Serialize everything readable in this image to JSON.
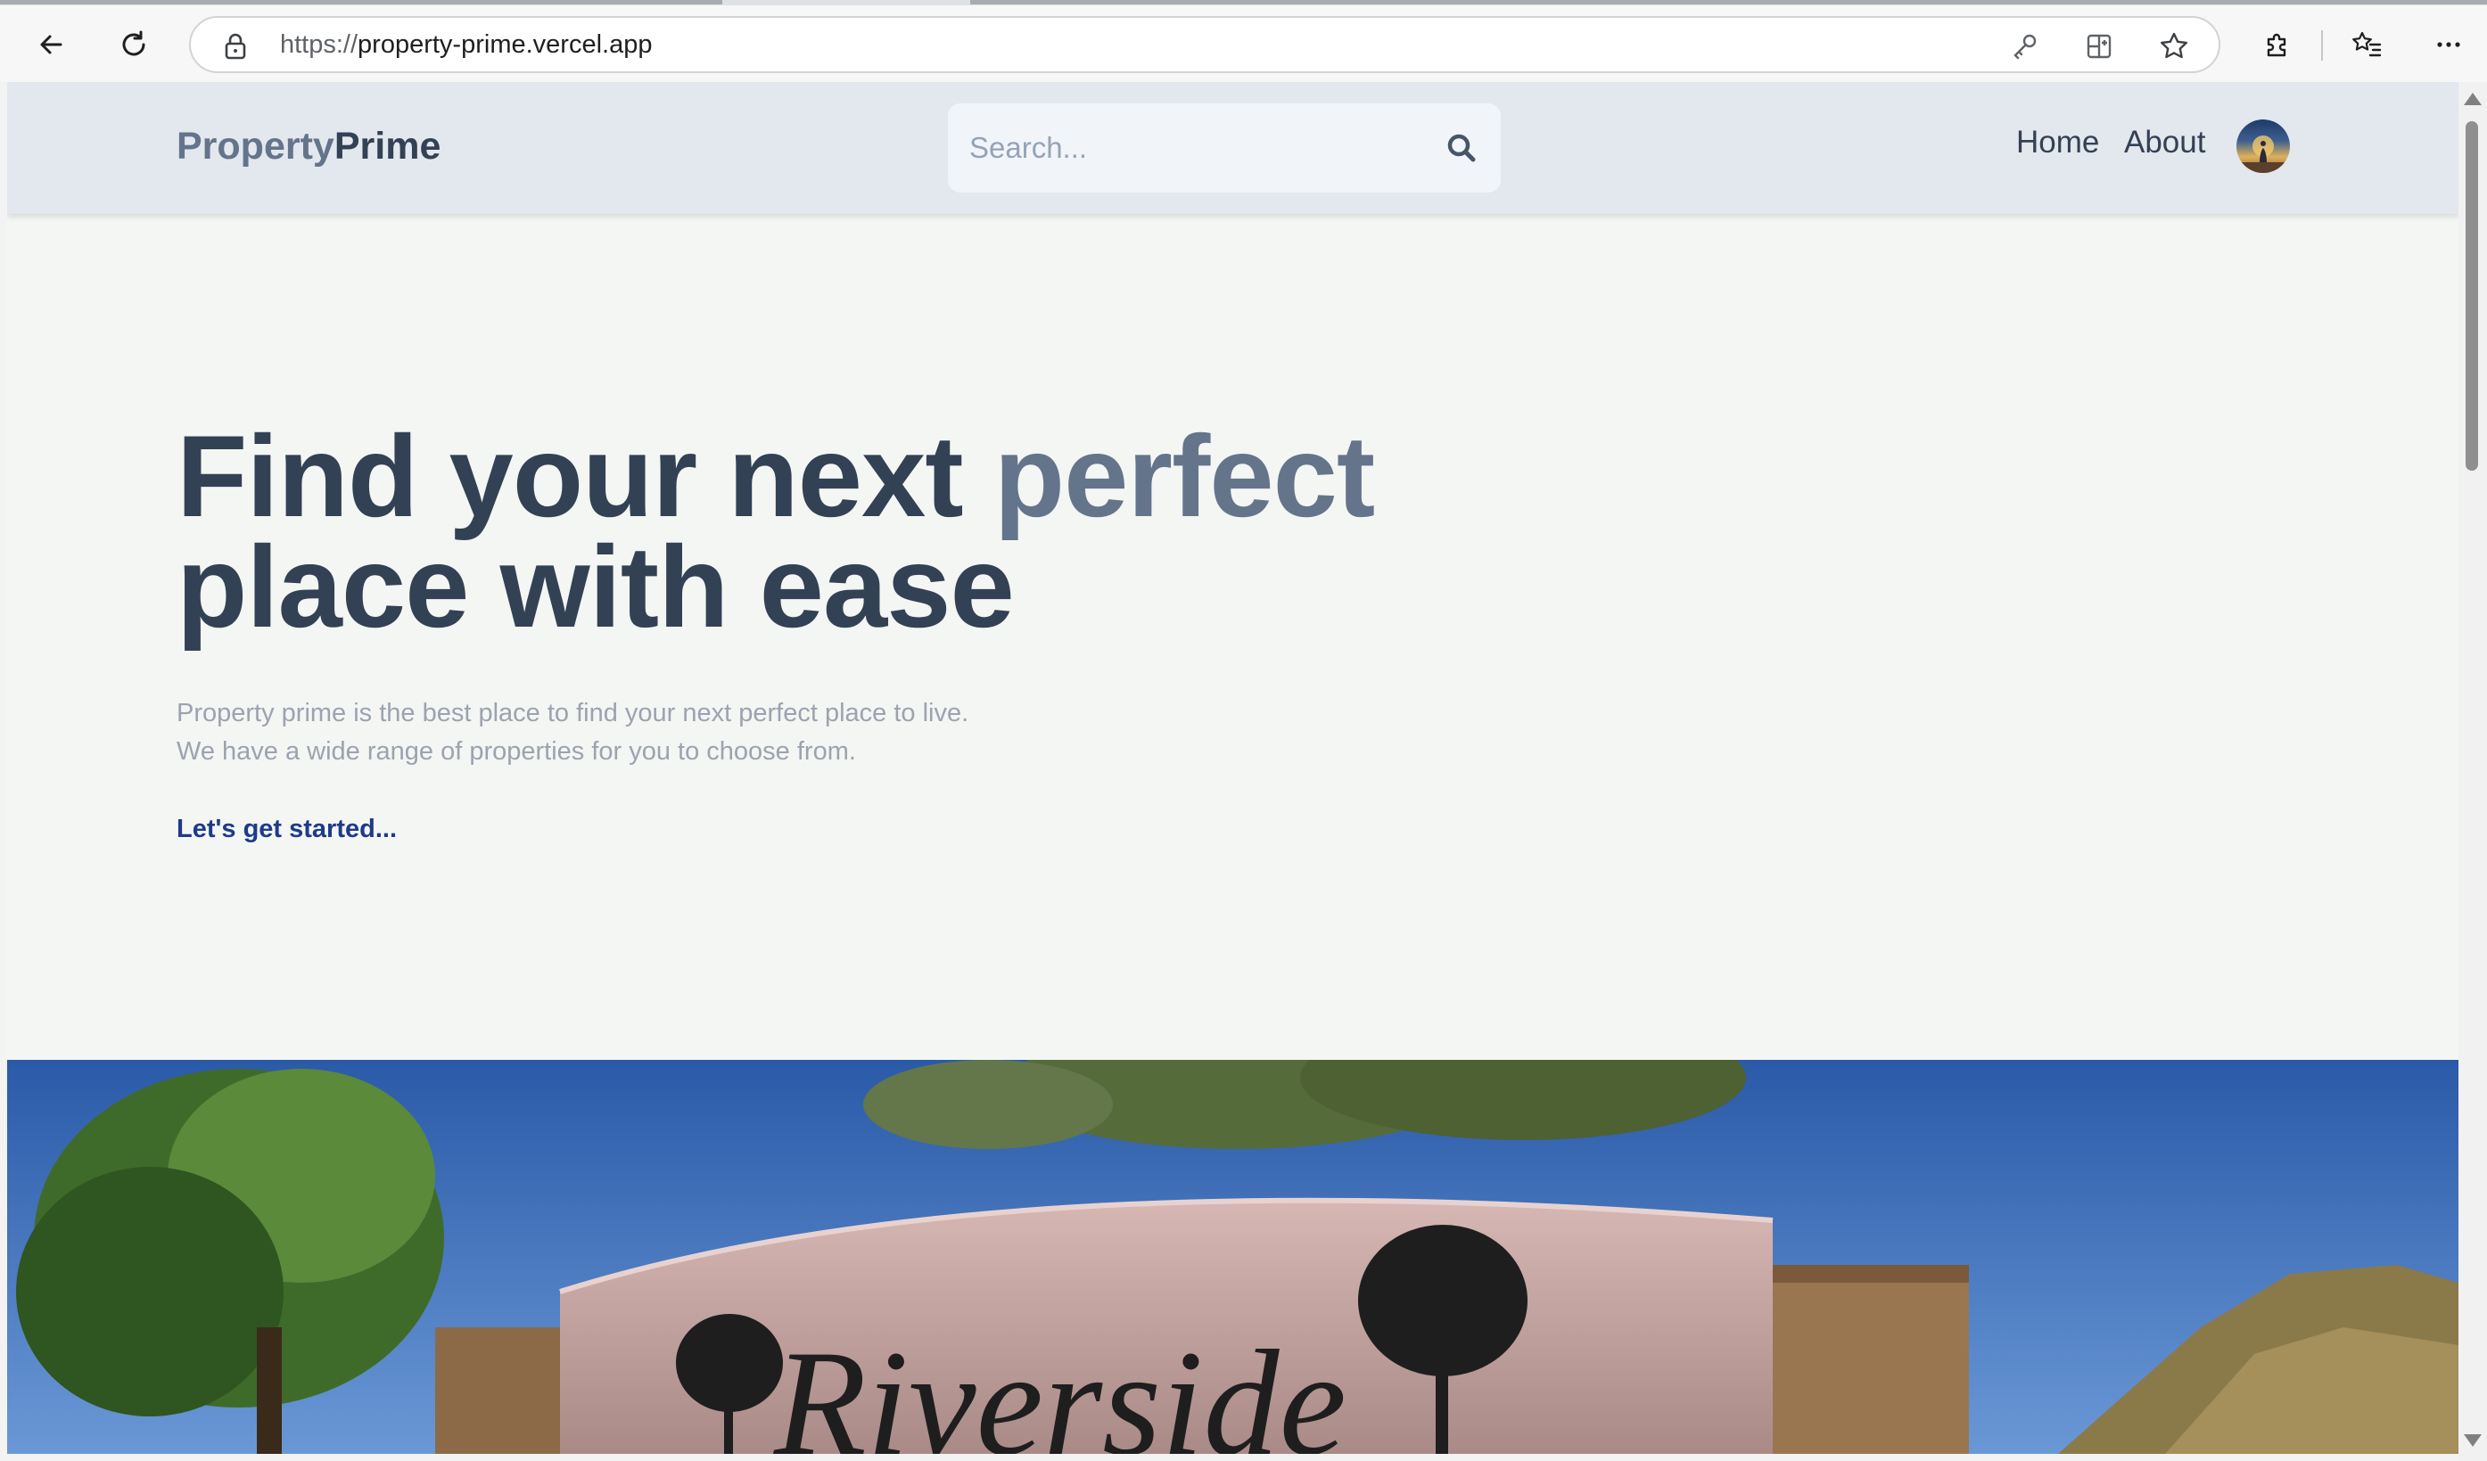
{
  "browser": {
    "url_protocol": "https://",
    "url_host": "property-prime.vercel.app",
    "icons": [
      "back-arrow-icon",
      "refresh-icon",
      "lock-icon",
      "key-icon",
      "split-screen-icon",
      "favorite-star-icon",
      "extensions-icon",
      "favorites-list-icon",
      "more-menu-icon"
    ]
  },
  "header": {
    "logo_part1": "Property",
    "logo_part2": "Prime",
    "search_placeholder": "Search...",
    "nav": [
      {
        "label": "Home"
      },
      {
        "label": "About"
      }
    ]
  },
  "hero": {
    "title_line1_a": "Find your next ",
    "title_line1_b": "perfect",
    "title_line2": "place with ease",
    "subtitle_line1": "Property prime is the best place to find your next perfect place to live.",
    "subtitle_line2": "We have a wide range of properties for you to choose from.",
    "cta": "Let's get started..."
  },
  "banner": {
    "sign_text": "Riverside"
  },
  "colors": {
    "header_bg": "#e3e7ee",
    "page_bg": "#f4f6f4",
    "title_dark": "#334155",
    "title_accent": "#64748b",
    "subtitle": "#9ca3af",
    "cta": "#1e3a8a"
  }
}
